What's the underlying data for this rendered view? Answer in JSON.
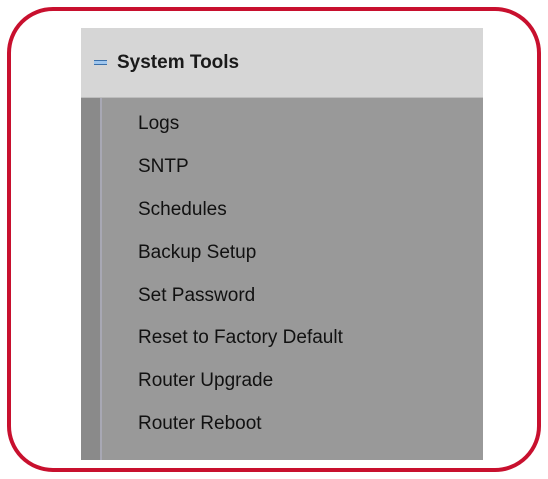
{
  "menu": {
    "title": "System Tools",
    "collapse_icon": "minus-icon",
    "items": [
      {
        "label": "Logs"
      },
      {
        "label": "SNTP"
      },
      {
        "label": "Schedules"
      },
      {
        "label": "Backup Setup"
      },
      {
        "label": "Set Password"
      },
      {
        "label": "Reset to Factory Default"
      },
      {
        "label": "Router Upgrade"
      },
      {
        "label": "Router Reboot"
      }
    ]
  },
  "colors": {
    "frame_border": "#c8102e",
    "menu_background": "#999999",
    "header_background": "#d6d6d6",
    "collapse_icon": "#9fc6ee"
  }
}
